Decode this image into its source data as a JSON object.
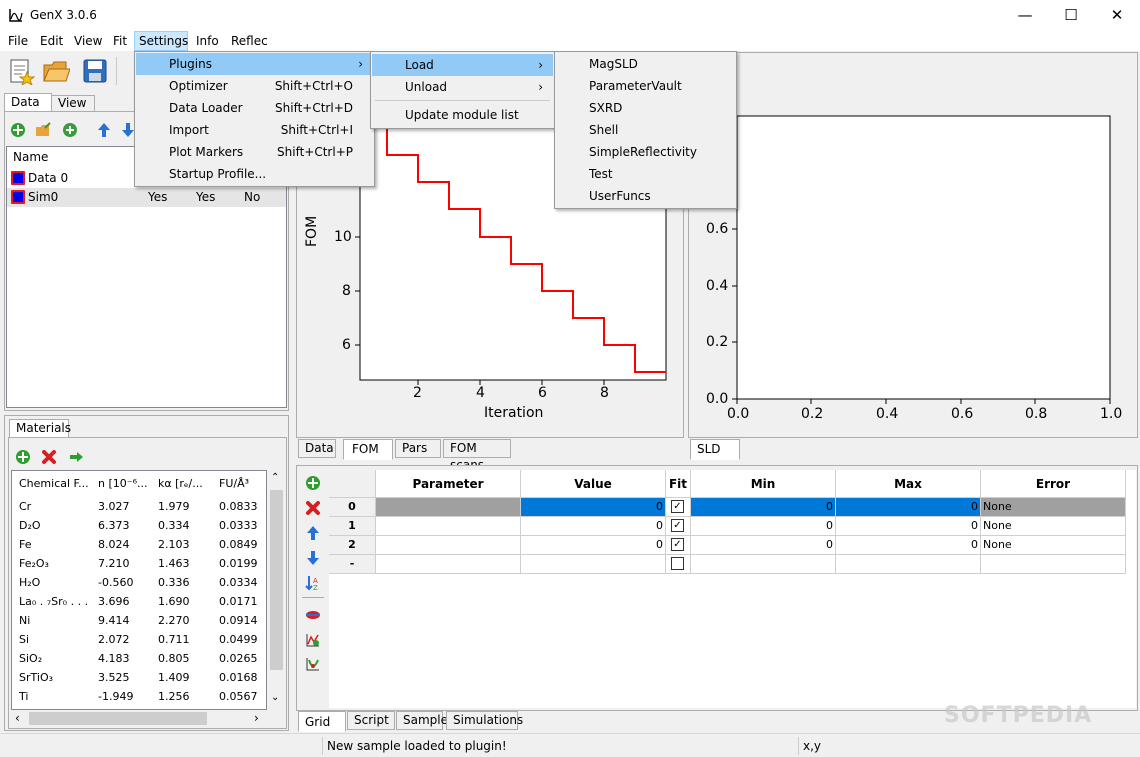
{
  "window": {
    "title": "GenX 3.0.6",
    "minimize": "—",
    "maximize": "☐",
    "close": "✕"
  },
  "menubar": [
    "File",
    "Edit",
    "View",
    "Fit",
    "Settings",
    "Info",
    "Reflec"
  ],
  "left_tabs": [
    "Data",
    "View"
  ],
  "data_list": {
    "header": "Name",
    "rows": [
      {
        "name": "Data 0",
        "c1": "",
        "c2": "",
        "c3": ""
      },
      {
        "name": "Sim0",
        "c1": "Yes",
        "c2": "Yes",
        "c3": "No"
      }
    ]
  },
  "materials": {
    "tab": "Materials",
    "headers": [
      "Chemical F...",
      "n [10⁻⁶...",
      "kα [rₑ/...",
      "FU/Å³"
    ],
    "rows": [
      [
        "Cr",
        "3.027",
        "1.979",
        "0.0833"
      ],
      [
        "D₂O",
        "6.373",
        "0.334",
        "0.0333"
      ],
      [
        "Fe",
        "8.024",
        "2.103",
        "0.0849"
      ],
      [
        "Fe₂O₃",
        "7.210",
        "1.463",
        "0.0199"
      ],
      [
        "H₂O",
        "-0.560",
        "0.336",
        "0.0334"
      ],
      [
        "La₀ . ₇Sr₀ . . .",
        "3.696",
        "1.690",
        "0.0171"
      ],
      [
        "Ni",
        "9.414",
        "2.270",
        "0.0914"
      ],
      [
        "Si",
        "2.072",
        "0.711",
        "0.0499"
      ],
      [
        "SiO₂",
        "4.183",
        "0.805",
        "0.0265"
      ],
      [
        "SrTiO₃",
        "3.525",
        "1.409",
        "0.0168"
      ],
      [
        "Ti",
        "-1.949",
        "1.256",
        "0.0567"
      ]
    ]
  },
  "fom_plot": {
    "ylabel": "FOM",
    "xlabel": "Iteration",
    "yticks": [
      "10",
      "8",
      "6"
    ],
    "xticks": [
      "2",
      "4",
      "6",
      "8"
    ]
  },
  "sld_plot": {
    "yticks": [
      "0.6",
      "0.4",
      "0.2",
      "0.0"
    ],
    "xticks": [
      "0.0",
      "0.2",
      "0.4",
      "0.6",
      "0.8",
      "1.0"
    ]
  },
  "plot_tabs": [
    "Data",
    "FOM",
    "Pars",
    "FOM scans"
  ],
  "sld_tab": "SLD",
  "grid": {
    "headers": [
      "Parameter",
      "Value",
      "Fit",
      "Min",
      "Max",
      "Error"
    ],
    "rows": [
      {
        "id": "0",
        "param": "",
        "value": "0",
        "fit": "✓",
        "min": "0",
        "max": "0",
        "error": "None"
      },
      {
        "id": "1",
        "param": "",
        "value": "0",
        "fit": "✓",
        "min": "0",
        "max": "0",
        "error": "None"
      },
      {
        "id": "2",
        "param": "",
        "value": "0",
        "fit": "✓",
        "min": "0",
        "max": "0",
        "error": "None"
      },
      {
        "id": "-",
        "param": "",
        "value": "",
        "fit": "",
        "min": "",
        "max": "",
        "error": ""
      }
    ]
  },
  "bottom_tabs": [
    "Grid",
    "Script",
    "Sample",
    "Simulations"
  ],
  "settings_menu": [
    {
      "label": "Plugins",
      "shortcut": "",
      "arrow": "›"
    },
    {
      "label": "Optimizer",
      "shortcut": "Shift+Ctrl+O",
      "arrow": ""
    },
    {
      "label": "Data Loader",
      "shortcut": "Shift+Ctrl+D",
      "arrow": ""
    },
    {
      "label": "Import",
      "shortcut": "Shift+Ctrl+I",
      "arrow": ""
    },
    {
      "label": "Plot Markers",
      "shortcut": "Shift+Ctrl+P",
      "arrow": ""
    },
    {
      "label": "Startup Profile...",
      "shortcut": "",
      "arrow": ""
    }
  ],
  "plugins_menu": [
    {
      "label": "Load",
      "arrow": "›"
    },
    {
      "label": "Unload",
      "arrow": "›"
    },
    {
      "label": "Update module list",
      "arrow": ""
    }
  ],
  "load_menu": [
    "MagSLD",
    "ParameterVault",
    "SXRD",
    "Shell",
    "SimpleReflectivity",
    "Test",
    "UserFuncs"
  ],
  "status": {
    "message": "New sample loaded to plugin!",
    "coords": "x,y"
  },
  "watermark": "SOFTPEDIA"
}
